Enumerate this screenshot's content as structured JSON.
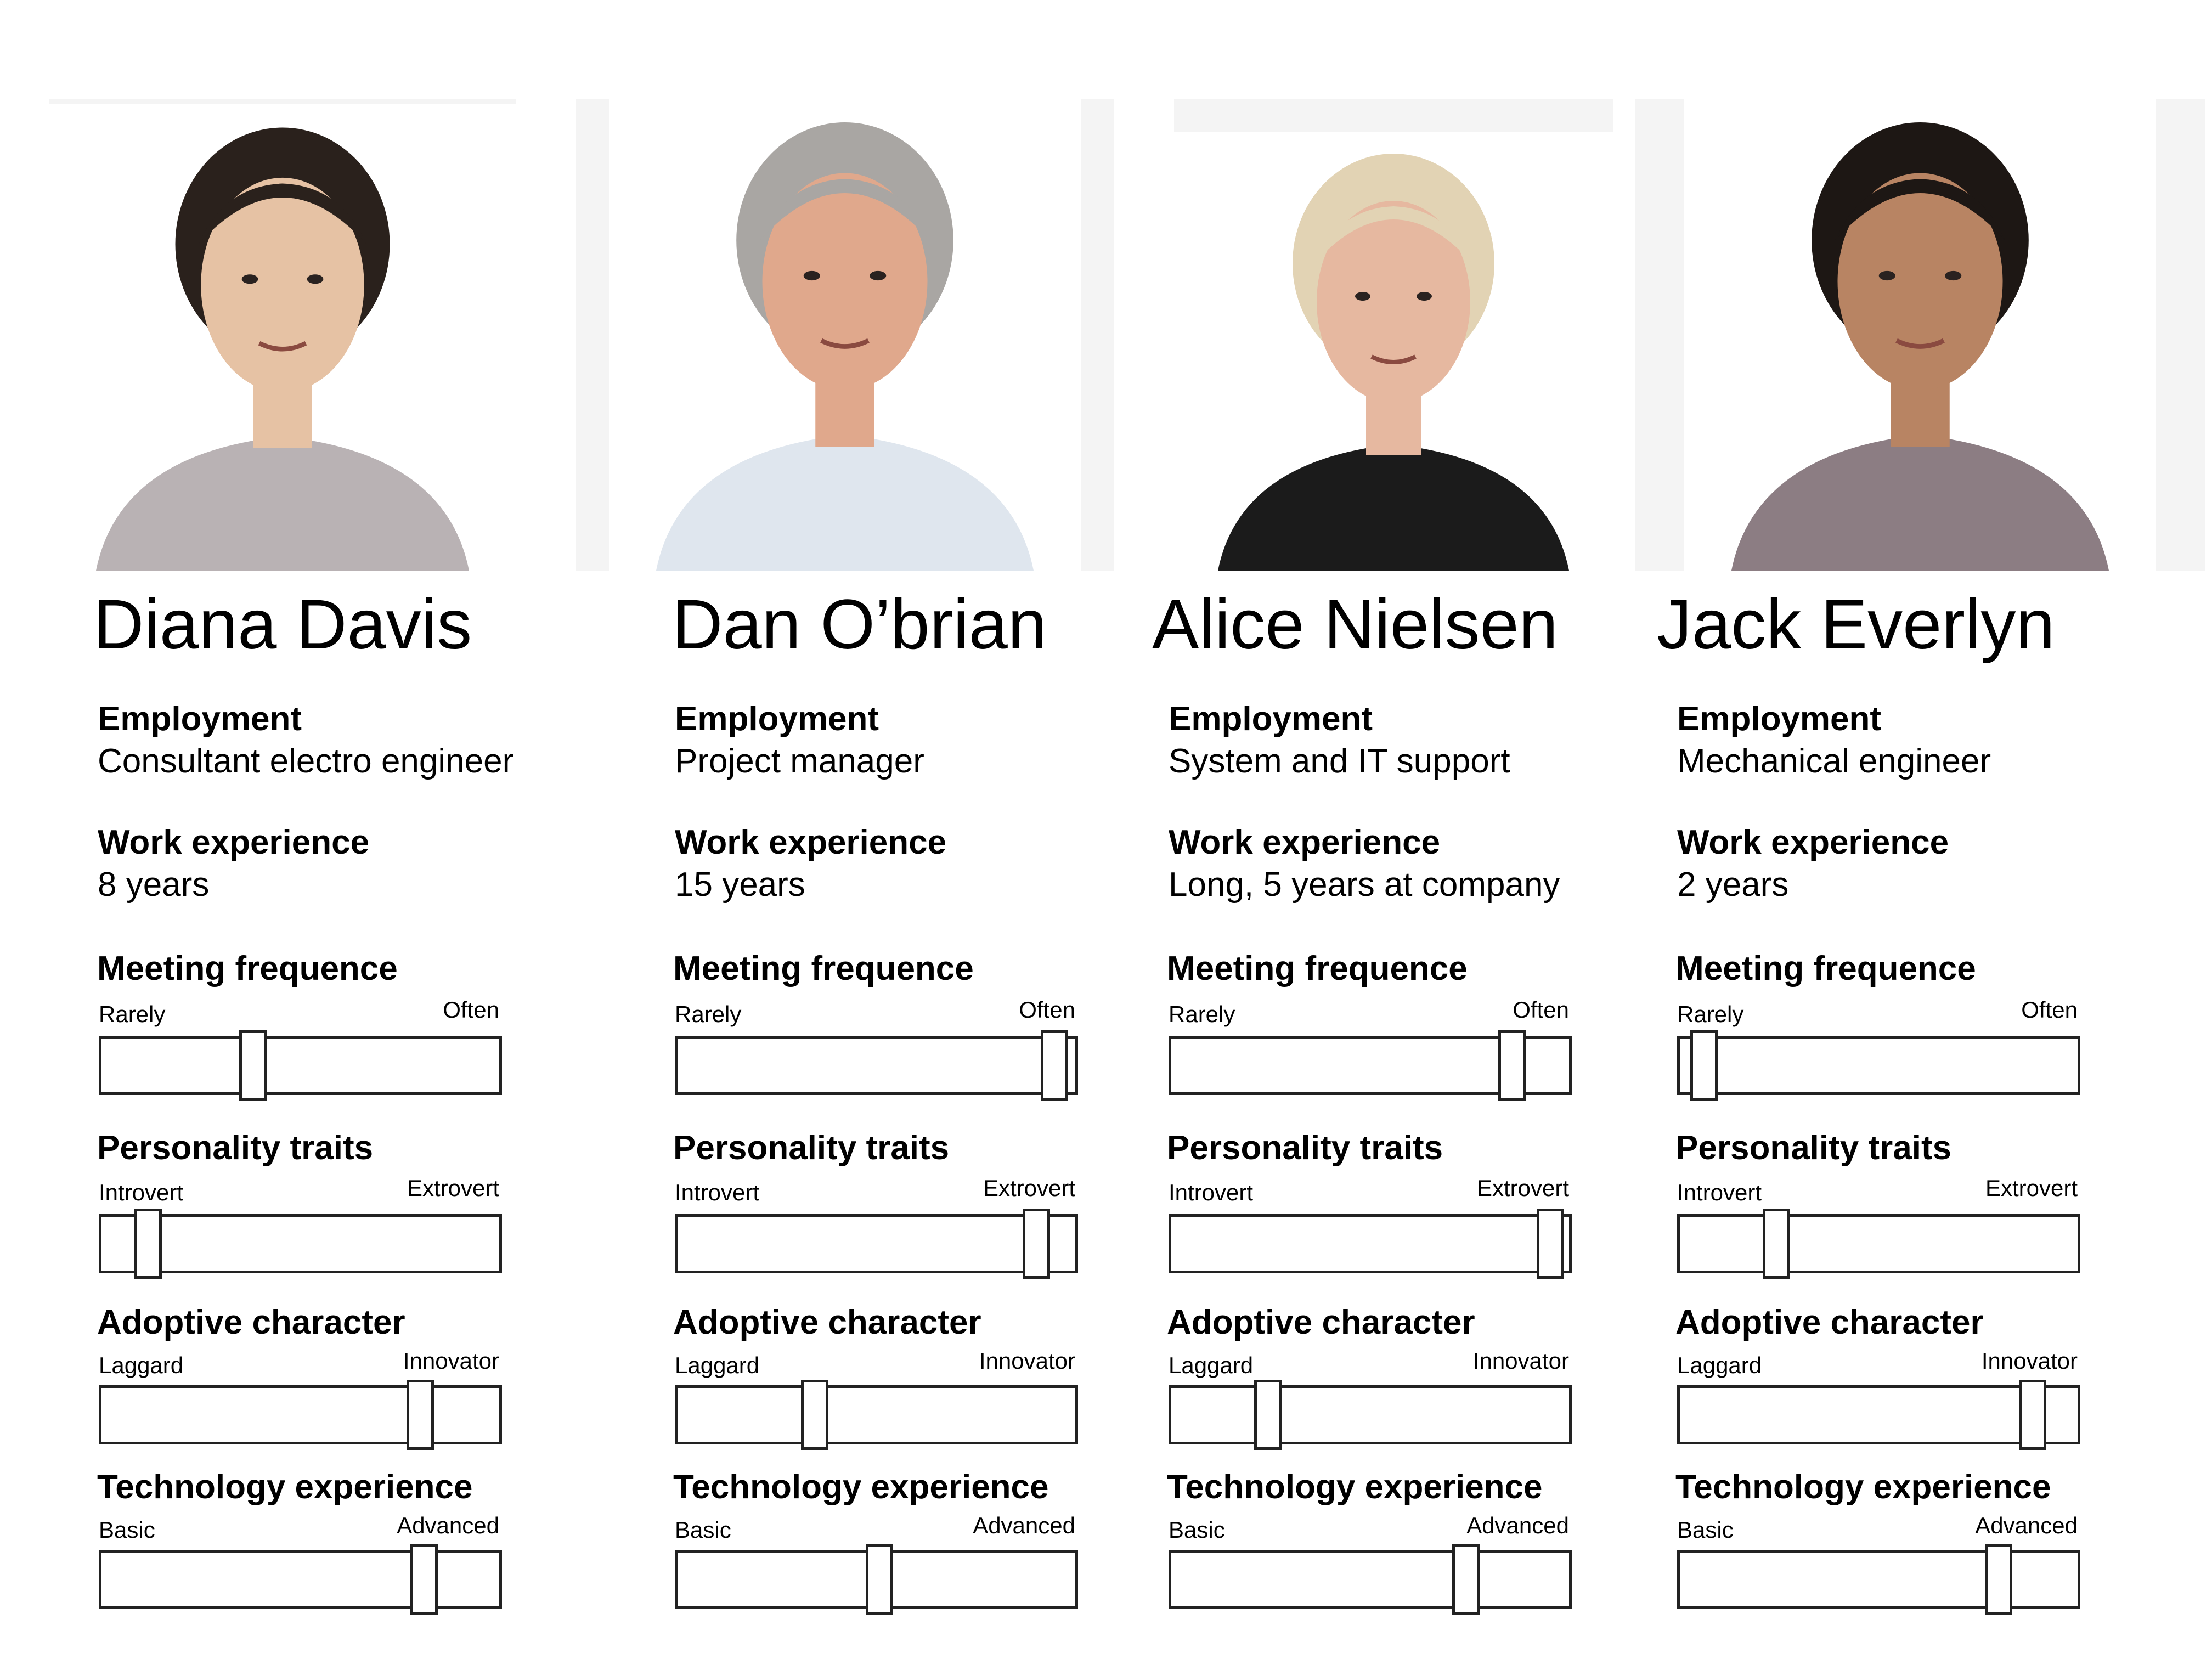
{
  "personas": [
    {
      "name": "Diana Davis",
      "employment_label": "Employment",
      "employment": "Consultant electro engineer",
      "experience_label": "Work experience",
      "experience": "8 years",
      "photo": {
        "skin": "#e6c2a4",
        "hair": "#2a211c",
        "shirt": "#b9b2b4"
      },
      "sliders": [
        {
          "label": "Meeting frequence",
          "low": "Rarely",
          "high": "Often",
          "value": 0.375
        },
        {
          "label": "Personality traits",
          "low": "Introvert",
          "high": "Extrovert",
          "value": 0.115
        },
        {
          "label": "Adoptive character",
          "low": "Laggard",
          "high": "Innovator",
          "value": 0.79
        },
        {
          "label": "Technology experience",
          "low": "Basic",
          "high": "Advanced",
          "value": 0.8
        }
      ]
    },
    {
      "name": "Dan O’brian",
      "employment_label": "Employment",
      "employment": "Project manager",
      "experience_label": "Work experience",
      "experience": "15 years",
      "photo": {
        "skin": "#e0a88c",
        "hair": "#a9a6a3",
        "shirt": "#dfe6ee"
      },
      "sliders": [
        {
          "label": "Meeting frequence",
          "low": "Rarely",
          "high": "Often",
          "value": 0.935
        },
        {
          "label": "Personality traits",
          "low": "Introvert",
          "high": "Extrovert",
          "value": 0.89
        },
        {
          "label": "Adoptive character",
          "low": "Laggard",
          "high": "Innovator",
          "value": 0.34
        },
        {
          "label": "Technology experience",
          "low": "Basic",
          "high": "Advanced",
          "value": 0.5
        }
      ]
    },
    {
      "name": "Alice Nielsen",
      "employment_label": "Employment",
      "employment": "System and IT support",
      "experience_label": "Work experience",
      "experience": "Long, 5 years at company",
      "photo": {
        "skin": "#e6b8a0",
        "hair": "#e2d3b4",
        "shirt": "#1b1b1b"
      },
      "sliders": [
        {
          "label": "Meeting frequence",
          "low": "Rarely",
          "high": "Often",
          "value": 0.845
        },
        {
          "label": "Personality traits",
          "low": "Introvert",
          "high": "Extrovert",
          "value": 0.94
        },
        {
          "label": "Adoptive character",
          "low": "Laggard",
          "high": "Innovator",
          "value": 0.24
        },
        {
          "label": "Technology experience",
          "low": "Basic",
          "high": "Advanced",
          "value": 0.73
        }
      ]
    },
    {
      "name": "Jack Everlyn",
      "employment_label": "Employment",
      "employment": "Mechanical engineer",
      "experience_label": "Work experience",
      "experience": "2 years",
      "photo": {
        "skin": "#b88463",
        "hair": "#1d1714",
        "shirt": "#8c7d83"
      },
      "sliders": [
        {
          "label": "Meeting frequence",
          "low": "Rarely",
          "high": "Often",
          "value": 0.06
        },
        {
          "label": "Personality traits",
          "low": "Introvert",
          "high": "Extrovert",
          "value": 0.24
        },
        {
          "label": "Adoptive character",
          "low": "Laggard",
          "high": "Innovator",
          "value": 0.875
        },
        {
          "label": "Technology experience",
          "low": "Basic",
          "high": "Advanced",
          "value": 0.79
        }
      ]
    }
  ]
}
